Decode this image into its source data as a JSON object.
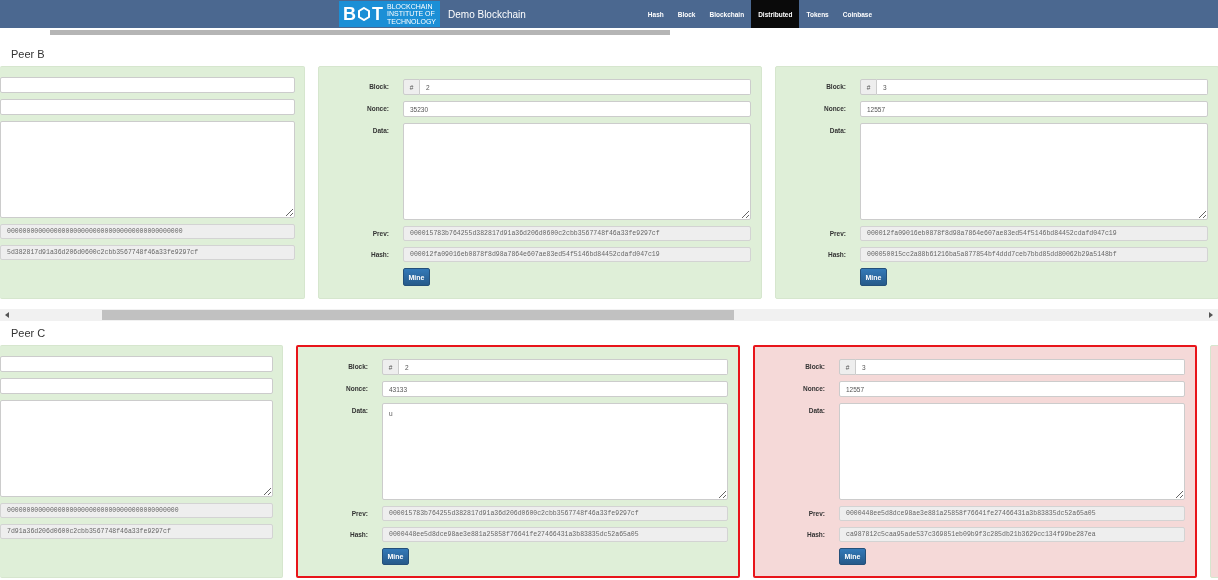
{
  "navbar": {
    "logo": {
      "letter_left": "B",
      "letter_right": "T",
      "lines": [
        "BLOCKCHAIN",
        "INSTITUTE OF",
        "TECHNOLOGY"
      ]
    },
    "title": "Demo Blockchain",
    "items": [
      {
        "label": "Hash",
        "selected": false
      },
      {
        "label": "Block",
        "selected": false
      },
      {
        "label": "Blockchain",
        "selected": false
      },
      {
        "label": "Distributed",
        "selected": true
      },
      {
        "label": "Tokens",
        "selected": false
      },
      {
        "label": "Coinbase",
        "selected": false
      }
    ]
  },
  "peers": [
    {
      "name": "Peer B",
      "blocks": [
        {
          "kind": "partial",
          "valid": true,
          "highlighted": false,
          "prev": "000000000000000000000000000000000000000000000",
          "hash": "5d382817d91a36d206d0600c2cbb3567748f46a33fe9297cf"
        },
        {
          "kind": "full",
          "valid": true,
          "highlighted": false,
          "block_label": "Block:",
          "addon": "#",
          "number": "2",
          "nonce_label": "Nonce:",
          "nonce": "35230",
          "data_label": "Data:",
          "prev_label": "Prev:",
          "prev": "000015783b764255d382817d91a36d206d0600c2cbb3567748f46a33fe9297cf",
          "hash_label": "Hash:",
          "hash": "000012fa09016eb0878f8d98a7864e607ae83ed54f5146bd84452cdafd047c19",
          "mine": "Mine"
        },
        {
          "kind": "full",
          "valid": true,
          "highlighted": false,
          "block_label": "Block:",
          "addon": "#",
          "number": "3",
          "nonce_label": "Nonce:",
          "nonce": "12557",
          "data_label": "Data:",
          "prev_label": "Prev:",
          "prev": "000012fa09016eb0878f8d98a7864e607ae83ed54f5146bd84452cdafd047c19",
          "hash_label": "Hash:",
          "hash": "000050015cc2a88b61216ba5a877854bf4ddd7ceb7bbd85dd80062b29a5148bf",
          "mine": "Mine"
        }
      ]
    },
    {
      "name": "Peer C",
      "blocks": [
        {
          "kind": "partial",
          "valid": true,
          "highlighted": false,
          "prev": "00000000000000000000000000000000000000000000",
          "hash": "7d91a36d206d0600c2cbb3567748f46a33fe9297cf"
        },
        {
          "kind": "full",
          "valid": true,
          "highlighted": true,
          "block_label": "Block:",
          "addon": "#",
          "number": "2",
          "nonce_label": "Nonce:",
          "nonce": "43133",
          "data_label": "Data:",
          "data": "u",
          "prev_label": "Prev:",
          "prev": "000015783b764255d382817d91a36d206d0600c2cbb3567748f46a33fe9297cf",
          "hash_label": "Hash:",
          "hash": "0000448ee5d8dce98ae3e881a25858f76641fe27466431a3b83835dc52a65a05",
          "mine": "Mine"
        },
        {
          "kind": "full",
          "valid": false,
          "highlighted": true,
          "block_label": "Block:",
          "addon": "#",
          "number": "3",
          "nonce_label": "Nonce:",
          "nonce": "12557",
          "data_label": "Data:",
          "prev_label": "Prev:",
          "prev": "0000448ee5d8dce98ae3e881a25858f76641fe27466431a3b83835dc52a65a05",
          "hash_label": "Hash:",
          "hash": "ca987812c5caa95ade537c369851eb09b9f3c285db21b3629cc134f99be287ea",
          "mine": "Mine"
        },
        {
          "kind": "edge",
          "valid": false
        }
      ]
    }
  ]
}
